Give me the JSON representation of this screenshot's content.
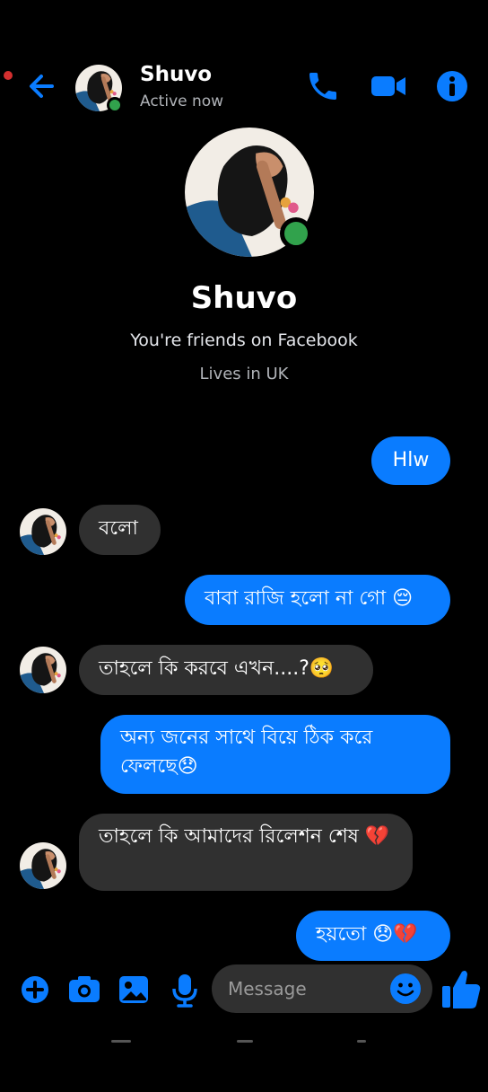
{
  "header": {
    "contact_name": "Shuvo",
    "status": "Active now"
  },
  "profile": {
    "name": "Shuvo",
    "relationship": "You're friends on Facebook",
    "location": "Lives in UK"
  },
  "messages": [
    {
      "direction": "out",
      "text": "Hlw"
    },
    {
      "direction": "in",
      "text": "বলো"
    },
    {
      "direction": "out",
      "text": "বাবা রাজি হলো না গো 😔"
    },
    {
      "direction": "in",
      "text": "তাহলে কি করবে এখন....?🥺"
    },
    {
      "direction": "out",
      "text": "অন্য জনের সাথে বিয়ে ঠিক করে ফেলছে😞"
    },
    {
      "direction": "in",
      "text": "তাহলে কি আমাদের রিলেশন শেষ 💔"
    },
    {
      "direction": "out",
      "text": "হয়তো 😞💔"
    }
  ],
  "composer": {
    "placeholder": "Message"
  },
  "colors": {
    "accent": "#0a7cff",
    "incoming_bubble": "#303030",
    "online": "#31a24c",
    "background": "#000000"
  },
  "icons": {
    "back": "arrow-left-icon",
    "call": "phone-icon",
    "video": "video-camera-icon",
    "info": "info-icon",
    "add": "plus-circle-icon",
    "camera": "camera-icon",
    "gallery": "image-icon",
    "mic": "microphone-icon",
    "emoji": "emoji-icon",
    "like": "thumbs-up-icon"
  }
}
